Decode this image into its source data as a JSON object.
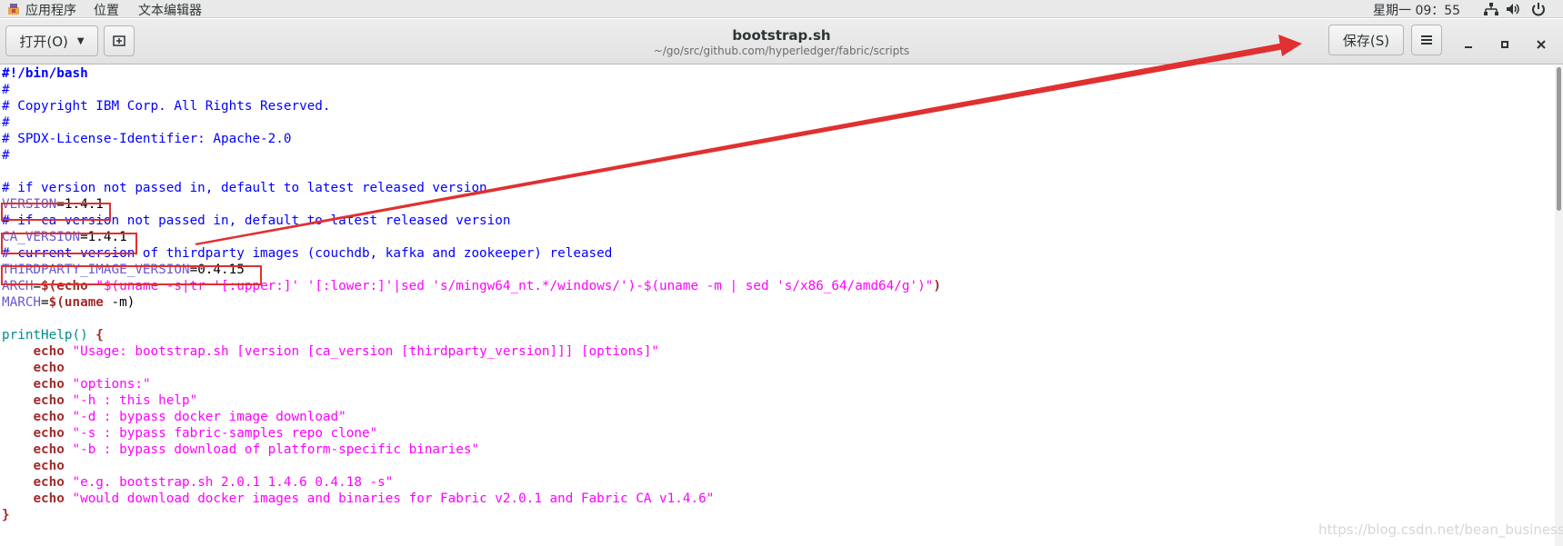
{
  "system_bar": {
    "menus": [
      "应用程序",
      "位置",
      "文本编辑器"
    ],
    "clock": "星期一 09：55"
  },
  "header": {
    "open_label": "打开(O)",
    "title": "bootstrap.sh",
    "path": "~/go/src/github.com/hyperledger/fabric/scripts",
    "save_label": "保存(S)"
  },
  "code_lines": [
    [
      {
        "c": "shebang",
        "t": "#!/bin/bash"
      }
    ],
    [
      {
        "c": "com",
        "t": "#"
      }
    ],
    [
      {
        "c": "com",
        "t": "# Copyright IBM Corp. All Rights Reserved."
      }
    ],
    [
      {
        "c": "com",
        "t": "#"
      }
    ],
    [
      {
        "c": "com",
        "t": "# SPDX-License-Identifier: Apache-2.0"
      }
    ],
    [
      {
        "c": "com",
        "t": "#"
      }
    ],
    [],
    [
      {
        "c": "com",
        "t": "# if version not passed in, default to latest released version"
      }
    ],
    [
      {
        "c": "var",
        "t": "VERSION"
      },
      {
        "c": "txt",
        "t": "=1.4.1"
      }
    ],
    [
      {
        "c": "com",
        "t": "# if ca version not passed in, default to latest released version"
      }
    ],
    [
      {
        "c": "var",
        "t": "CA_VERSION"
      },
      {
        "c": "txt",
        "t": "=1.4.1"
      }
    ],
    [
      {
        "c": "com",
        "t": "# current version of thirdparty images (couchdb, kafka and zookeeper) released"
      }
    ],
    [
      {
        "c": "var",
        "t": "THIRDPARTY_IMAGE_VERSION"
      },
      {
        "c": "txt",
        "t": "=0.4.15"
      }
    ],
    [
      {
        "c": "var",
        "t": "ARCH"
      },
      {
        "c": "txt",
        "t": "="
      },
      {
        "c": "kw",
        "t": "$(echo "
      },
      {
        "c": "str",
        "t": "\"$(uname -s|tr '[:upper:]' '[:lower:]'|sed 's/mingw64_nt.*/windows/')-$(uname -m | sed 's/x86_64/amd64/g')\""
      },
      {
        "c": "kw",
        "t": ")"
      }
    ],
    [
      {
        "c": "var",
        "t": "MARCH"
      },
      {
        "c": "txt",
        "t": "="
      },
      {
        "c": "kw",
        "t": "$(uname"
      },
      {
        "c": "txt",
        "t": " -m)"
      }
    ],
    [],
    [
      {
        "c": "fn",
        "t": "printHelp() "
      },
      {
        "c": "br",
        "t": "{"
      }
    ],
    [
      {
        "c": "txt",
        "t": "    "
      },
      {
        "c": "kw",
        "t": "echo "
      },
      {
        "c": "str",
        "t": "\"Usage: bootstrap.sh [version [ca_version [thirdparty_version]]] [options]\""
      }
    ],
    [
      {
        "c": "txt",
        "t": "    "
      },
      {
        "c": "kw",
        "t": "echo"
      }
    ],
    [
      {
        "c": "txt",
        "t": "    "
      },
      {
        "c": "kw",
        "t": "echo "
      },
      {
        "c": "str",
        "t": "\"options:\""
      }
    ],
    [
      {
        "c": "txt",
        "t": "    "
      },
      {
        "c": "kw",
        "t": "echo "
      },
      {
        "c": "str",
        "t": "\"-h : this help\""
      }
    ],
    [
      {
        "c": "txt",
        "t": "    "
      },
      {
        "c": "kw",
        "t": "echo "
      },
      {
        "c": "str",
        "t": "\"-d : bypass docker image download\""
      }
    ],
    [
      {
        "c": "txt",
        "t": "    "
      },
      {
        "c": "kw",
        "t": "echo "
      },
      {
        "c": "str",
        "t": "\"-s : bypass fabric-samples repo clone\""
      }
    ],
    [
      {
        "c": "txt",
        "t": "    "
      },
      {
        "c": "kw",
        "t": "echo "
      },
      {
        "c": "str",
        "t": "\"-b : bypass download of platform-specific binaries\""
      }
    ],
    [
      {
        "c": "txt",
        "t": "    "
      },
      {
        "c": "kw",
        "t": "echo"
      }
    ],
    [
      {
        "c": "txt",
        "t": "    "
      },
      {
        "c": "kw",
        "t": "echo "
      },
      {
        "c": "str",
        "t": "\"e.g. bootstrap.sh 2.0.1 1.4.6 0.4.18 -s\""
      }
    ],
    [
      {
        "c": "txt",
        "t": "    "
      },
      {
        "c": "kw",
        "t": "echo "
      },
      {
        "c": "str",
        "t": "\"would download docker images and binaries for Fabric v2.0.1 and Fabric CA v1.4.6\""
      }
    ],
    [
      {
        "c": "br",
        "t": "}"
      }
    ]
  ],
  "watermark": "https://blog.csdn.net/bean_business",
  "colors": {
    "comment": "#0000ff",
    "variable": "#6a5acd",
    "string": "#ff00ff",
    "keyword": "#a52a2a",
    "function": "#008b8b",
    "annotation_red": "#e03030"
  }
}
